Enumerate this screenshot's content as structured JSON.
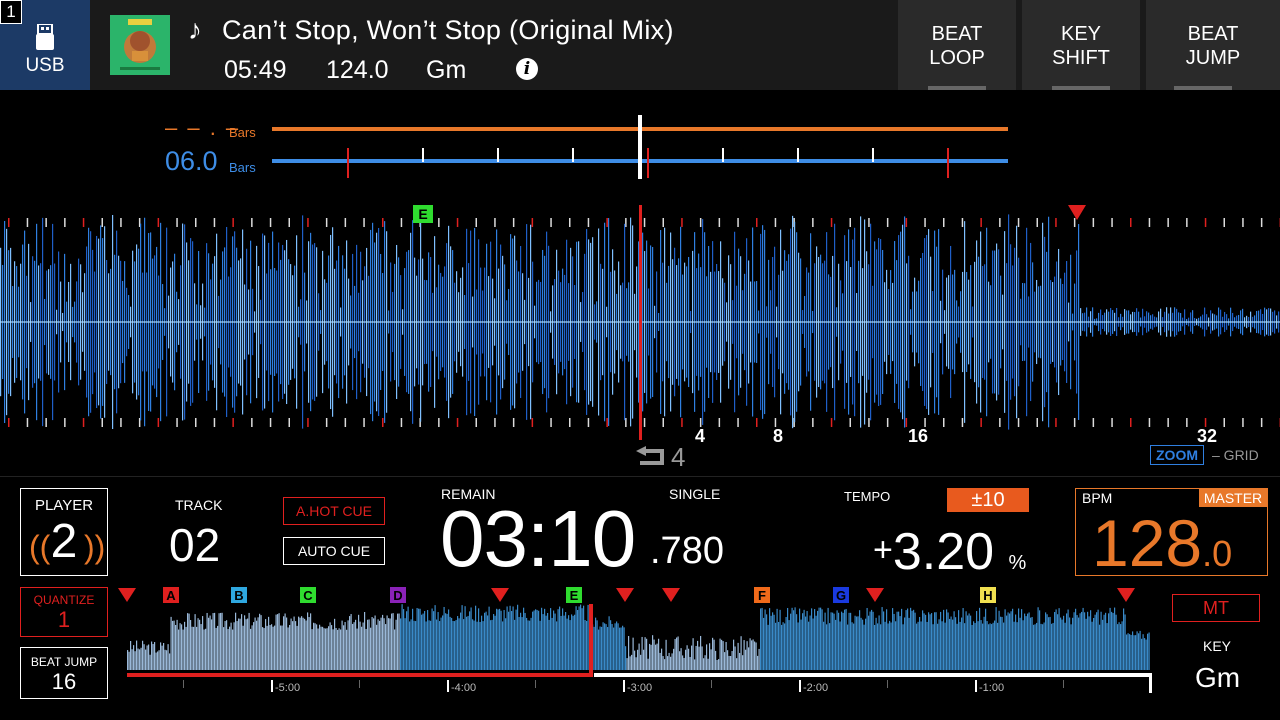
{
  "header": {
    "deck_number": "1",
    "source_label": "USB",
    "track_title": "Can’t Stop, Won’t Stop (Original Mix)",
    "track_length": "05:49",
    "track_bpm": "124.0",
    "track_key": "Gm",
    "info_icon": "i",
    "buttons": [
      {
        "line1": "BEAT",
        "line2": "LOOP"
      },
      {
        "line1": "KEY",
        "line2": "SHIFT"
      },
      {
        "line1": "BEAT",
        "line2": "JUMP"
      }
    ]
  },
  "bars": {
    "master_value": "– – . –",
    "master_unit": "Bars",
    "this_value": "06.0",
    "this_unit": "Bars"
  },
  "waveform": {
    "beat_labels": [
      "4",
      "8",
      "16",
      "32"
    ],
    "hot_cue_label": "E",
    "zoom_label": "ZOOM",
    "grid_label": "– GRID",
    "loop_beats": "4"
  },
  "player": {
    "label": "PLAYER",
    "number": "2",
    "left_bracket": "((",
    "right_bracket": "))"
  },
  "track": {
    "label": "TRACK",
    "number": "02"
  },
  "cue_buttons": {
    "hot_cue": "A.HOT CUE",
    "auto_cue": "AUTO CUE"
  },
  "time": {
    "mode_label": "REMAIN",
    "play_mode": "SINGLE",
    "display": "03:10",
    "millis": ".780"
  },
  "tempo": {
    "label": "TEMPO",
    "range": "±10",
    "sign": "+",
    "value": "3.20",
    "unit": "%"
  },
  "bpm": {
    "label": "BPM",
    "master_label": "MASTER",
    "value": "128",
    "decimal": ".0"
  },
  "quantize": {
    "label": "QUANTIZE",
    "value": "1"
  },
  "beat_jump": {
    "label": "BEAT JUMP",
    "value": "16"
  },
  "master_tempo": {
    "label": "MT"
  },
  "key": {
    "label": "KEY",
    "value": "Gm"
  },
  "overview": {
    "time_labels": [
      "-5:00",
      "-4:00",
      "-3:00",
      "-2:00",
      "-1:00"
    ],
    "hot_cues": [
      {
        "label": "A",
        "color": "#e0201f"
      },
      {
        "label": "B",
        "color": "#2fa8e0"
      },
      {
        "label": "C",
        "color": "#2fdc2f"
      },
      {
        "label": "D",
        "color": "#8a22b8"
      },
      {
        "label": "E",
        "color": "#2fdc2f"
      },
      {
        "label": "F",
        "color": "#f06a1a"
      },
      {
        "label": "G",
        "color": "#1a3ae0"
      },
      {
        "label": "H",
        "color": "#f0e050"
      }
    ],
    "play_position": 0.454
  },
  "colors": {
    "accent_orange": "#e8782a",
    "accent_blue": "#3e8de6",
    "alert_red": "#e0201f",
    "usb_bg": "#1c3a66"
  }
}
